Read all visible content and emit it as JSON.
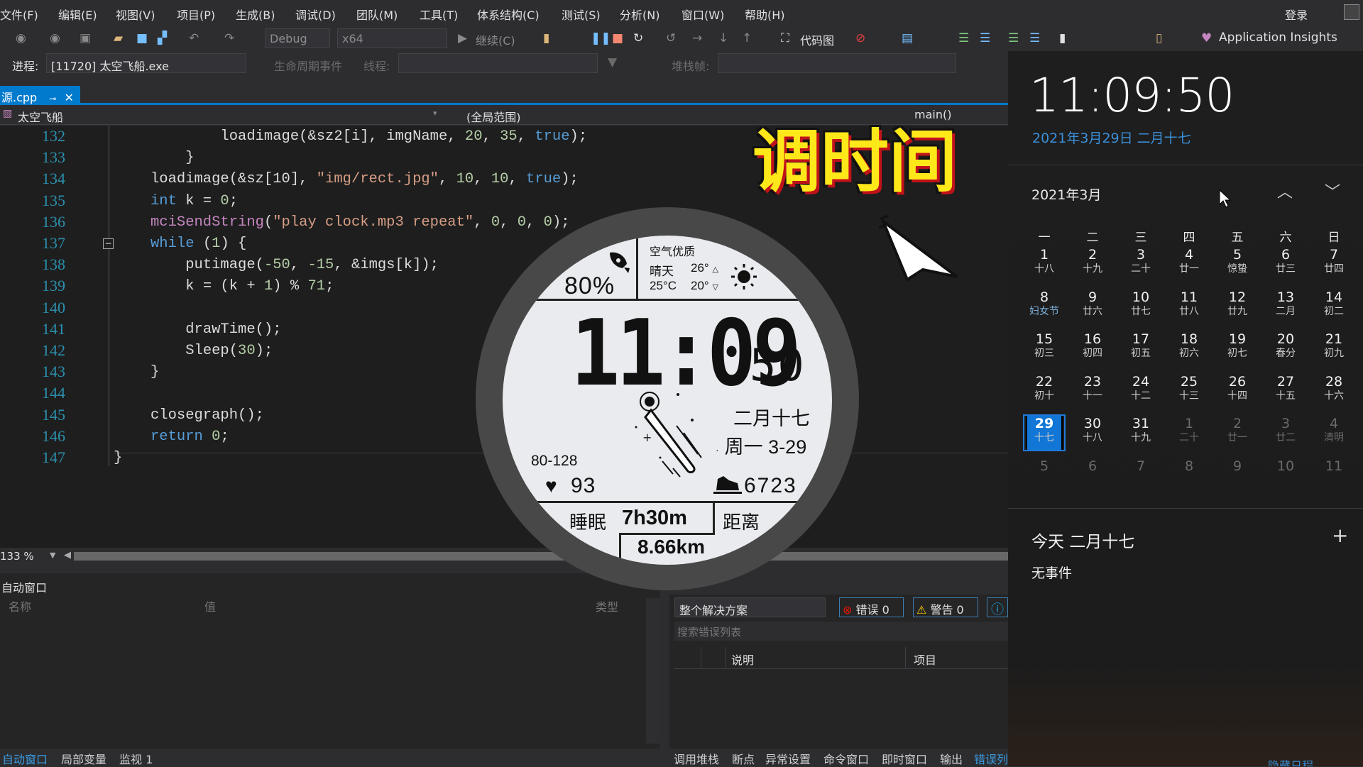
{
  "menu": [
    "文件(F)",
    "编辑(E)",
    "视图(V)",
    "项目(P)",
    "生成(B)",
    "调试(D)",
    "团队(M)",
    "工具(T)",
    "体系结构(C)",
    "测试(S)",
    "分析(N)",
    "窗口(W)",
    "帮助(H)"
  ],
  "account": {
    "login": "登录"
  },
  "toolbar": {
    "config": "Debug",
    "platform": "x64",
    "continue": "继续(C)",
    "codemap": "代码图",
    "insights": "Application Insights"
  },
  "process_bar": {
    "process_label": "进程:",
    "process_value": "[11720] 太空飞船.exe",
    "lifecycle": "生命周期事件",
    "thread_label": "线程:",
    "stackframe_label": "堆栈帧:"
  },
  "editor": {
    "tab": "源.cpp",
    "project_combo": "太空飞船",
    "scope_combo": "(全局范围)",
    "member_combo": "main()",
    "zoom": "133 %",
    "lines": [
      {
        "num": "132",
        "indent": "        ",
        "tokens": [
          {
            "t": "loadimage(&sz2[i], imgName, ",
            "k": "pl"
          },
          {
            "t": "20",
            "k": "num"
          },
          {
            "t": ", ",
            "k": "pl"
          },
          {
            "t": "35",
            "k": "num"
          },
          {
            "t": ", ",
            "k": "pl"
          },
          {
            "t": "true",
            "k": "kw"
          },
          {
            "t": ");",
            "k": "pl"
          }
        ]
      },
      {
        "num": "133",
        "indent": "    ",
        "tokens": [
          {
            "t": "}",
            "k": "pl"
          }
        ]
      },
      {
        "num": "134",
        "indent": "",
        "tokens": [
          {
            "t": "loadimage(&sz[10], ",
            "k": "pl"
          },
          {
            "t": "\"img/rect.jpg\"",
            "k": "str"
          },
          {
            "t": ", ",
            "k": "pl"
          },
          {
            "t": "10",
            "k": "num"
          },
          {
            "t": ", ",
            "k": "pl"
          },
          {
            "t": "10",
            "k": "num"
          },
          {
            "t": ", ",
            "k": "pl"
          },
          {
            "t": "true",
            "k": "kw"
          },
          {
            "t": ");",
            "k": "pl"
          }
        ]
      },
      {
        "num": "135",
        "indent": "",
        "tokens": [
          {
            "t": "int",
            "k": "kw"
          },
          {
            "t": " k = ",
            "k": "pl"
          },
          {
            "t": "0",
            "k": "num"
          },
          {
            "t": ";",
            "k": "pl"
          }
        ]
      },
      {
        "num": "136",
        "indent": "",
        "tokens": [
          {
            "t": "mciSendString",
            "k": "fn"
          },
          {
            "t": "(",
            "k": "pl"
          },
          {
            "t": "\"play clock.mp3 repeat\"",
            "k": "str"
          },
          {
            "t": ", ",
            "k": "pl"
          },
          {
            "t": "0",
            "k": "num"
          },
          {
            "t": ", ",
            "k": "pl"
          },
          {
            "t": "0",
            "k": "num"
          },
          {
            "t": ", ",
            "k": "pl"
          },
          {
            "t": "0",
            "k": "num"
          },
          {
            "t": ");",
            "k": "pl"
          }
        ]
      },
      {
        "num": "137",
        "indent": "",
        "tokens": [
          {
            "t": "while",
            "k": "kw"
          },
          {
            "t": " (",
            "k": "pl"
          },
          {
            "t": "1",
            "k": "num"
          },
          {
            "t": ") {",
            "k": "pl"
          }
        ]
      },
      {
        "num": "138",
        "indent": "    ",
        "tokens": [
          {
            "t": "putimage(",
            "k": "pl"
          },
          {
            "t": "-50",
            "k": "num"
          },
          {
            "t": ", ",
            "k": "pl"
          },
          {
            "t": "-15",
            "k": "num"
          },
          {
            "t": ", &imgs[k]);",
            "k": "pl"
          }
        ]
      },
      {
        "num": "139",
        "indent": "    ",
        "tokens": [
          {
            "t": "k = (k + ",
            "k": "pl"
          },
          {
            "t": "1",
            "k": "num"
          },
          {
            "t": ") % ",
            "k": "pl"
          },
          {
            "t": "71",
            "k": "num"
          },
          {
            "t": ";",
            "k": "pl"
          }
        ]
      },
      {
        "num": "140",
        "indent": "",
        "tokens": []
      },
      {
        "num": "141",
        "indent": "    ",
        "tokens": [
          {
            "t": "drawTime();",
            "k": "pl"
          }
        ]
      },
      {
        "num": "142",
        "indent": "    ",
        "tokens": [
          {
            "t": "Sleep(",
            "k": "pl"
          },
          {
            "t": "30",
            "k": "num"
          },
          {
            "t": ");",
            "k": "pl"
          }
        ]
      },
      {
        "num": "143",
        "indent": "",
        "tokens": [
          {
            "t": "}",
            "k": "pl"
          }
        ]
      },
      {
        "num": "144",
        "indent": "",
        "tokens": []
      },
      {
        "num": "145",
        "indent": "",
        "tokens": [
          {
            "t": "closegraph();",
            "k": "pl"
          }
        ]
      },
      {
        "num": "146",
        "indent": "",
        "tokens": [
          {
            "t": "return",
            "k": "kw"
          },
          {
            "t": " ",
            "k": "pl"
          },
          {
            "t": "0",
            "k": "num"
          },
          {
            "t": ";",
            "k": "pl"
          }
        ]
      },
      {
        "num": "147",
        "indent": "",
        "tokens": [
          {
            "t": "}",
            "k": "pl"
          }
        ],
        "outdent": true
      }
    ]
  },
  "overlay_title": "调时间",
  "watch": {
    "battery": "80%",
    "air_quality": "空气优质",
    "weather": "晴天",
    "temp_now": "25°C",
    "temp_high": "26°",
    "temp_low": "20°",
    "time_hm": "11:09",
    "time_s": "50",
    "lunar": "二月十七",
    "weekday_date": "周一 3-29",
    "heart_range": "80-128",
    "heart_rate": "93",
    "steps": "6723",
    "sleep_label": "睡眠",
    "sleep_value": "7h30m",
    "distance_label": "距离",
    "distance_value": "8.66km"
  },
  "auto_window": {
    "title": "自动窗口",
    "columns": [
      "名称",
      "值",
      "类型"
    ]
  },
  "error_list": {
    "scope": "整个解决方案",
    "errors": "错误 0",
    "warnings": "警告 0",
    "search_placeholder": "搜索错误列表",
    "columns": [
      "说明",
      "项目"
    ]
  },
  "bottom_tabs_left": [
    {
      "label": "自动窗口",
      "active": true
    },
    {
      "label": "局部变量"
    },
    {
      "label": "监视 1"
    }
  ],
  "bottom_tabs_right": [
    {
      "label": "调用堆栈"
    },
    {
      "label": "断点"
    },
    {
      "label": "异常设置"
    },
    {
      "label": "命令窗口"
    },
    {
      "label": "即时窗口"
    },
    {
      "label": "输出"
    },
    {
      "label": "错误列",
      "active": true
    }
  ],
  "clock_flyout": {
    "time": "11:09:50",
    "date": "2021年3月29日 二月十七",
    "month_title": "2021年3月",
    "weekdays": [
      "一",
      "二",
      "三",
      "四",
      "五",
      "六",
      "日"
    ],
    "days": [
      {
        "d": "1",
        "l": "十八"
      },
      {
        "d": "2",
        "l": "十九"
      },
      {
        "d": "3",
        "l": "二十"
      },
      {
        "d": "4",
        "l": "廿一"
      },
      {
        "d": "5",
        "l": "惊蛰"
      },
      {
        "d": "6",
        "l": "廿三"
      },
      {
        "d": "7",
        "l": "廿四"
      },
      {
        "d": "8",
        "l": "妇女节",
        "fest": true
      },
      {
        "d": "9",
        "l": "廿六"
      },
      {
        "d": "10",
        "l": "廿七"
      },
      {
        "d": "11",
        "l": "廿八"
      },
      {
        "d": "12",
        "l": "廿九"
      },
      {
        "d": "13",
        "l": "二月"
      },
      {
        "d": "14",
        "l": "初二"
      },
      {
        "d": "15",
        "l": "初三"
      },
      {
        "d": "16",
        "l": "初四"
      },
      {
        "d": "17",
        "l": "初五"
      },
      {
        "d": "18",
        "l": "初六"
      },
      {
        "d": "19",
        "l": "初七"
      },
      {
        "d": "20",
        "l": "春分"
      },
      {
        "d": "21",
        "l": "初九"
      },
      {
        "d": "22",
        "l": "初十"
      },
      {
        "d": "23",
        "l": "十一"
      },
      {
        "d": "24",
        "l": "十二"
      },
      {
        "d": "25",
        "l": "十三"
      },
      {
        "d": "26",
        "l": "十四"
      },
      {
        "d": "27",
        "l": "十五"
      },
      {
        "d": "28",
        "l": "十六"
      },
      {
        "d": "29",
        "l": "十七",
        "selected": true
      },
      {
        "d": "30",
        "l": "十八"
      },
      {
        "d": "31",
        "l": "十九"
      },
      {
        "d": "1",
        "l": "二十",
        "muted": true
      },
      {
        "d": "2",
        "l": "廿一",
        "muted": true
      },
      {
        "d": "3",
        "l": "廿二",
        "muted": true
      },
      {
        "d": "4",
        "l": "清明",
        "muted": true
      },
      {
        "d": "5",
        "muted": true
      },
      {
        "d": "6",
        "muted": true
      },
      {
        "d": "7",
        "muted": true
      },
      {
        "d": "8",
        "muted": true
      },
      {
        "d": "9",
        "muted": true
      },
      {
        "d": "10",
        "muted": true
      },
      {
        "d": "11",
        "muted": true
      }
    ],
    "today_label": "今天 二月十七",
    "no_events": "无事件",
    "hide_agenda": "隐藏日程"
  },
  "colors": {
    "accent": "#007acc",
    "date_blue": "#3a8fd8",
    "selected_day": "#1176d6",
    "title_yellow": "#ffe81a"
  }
}
